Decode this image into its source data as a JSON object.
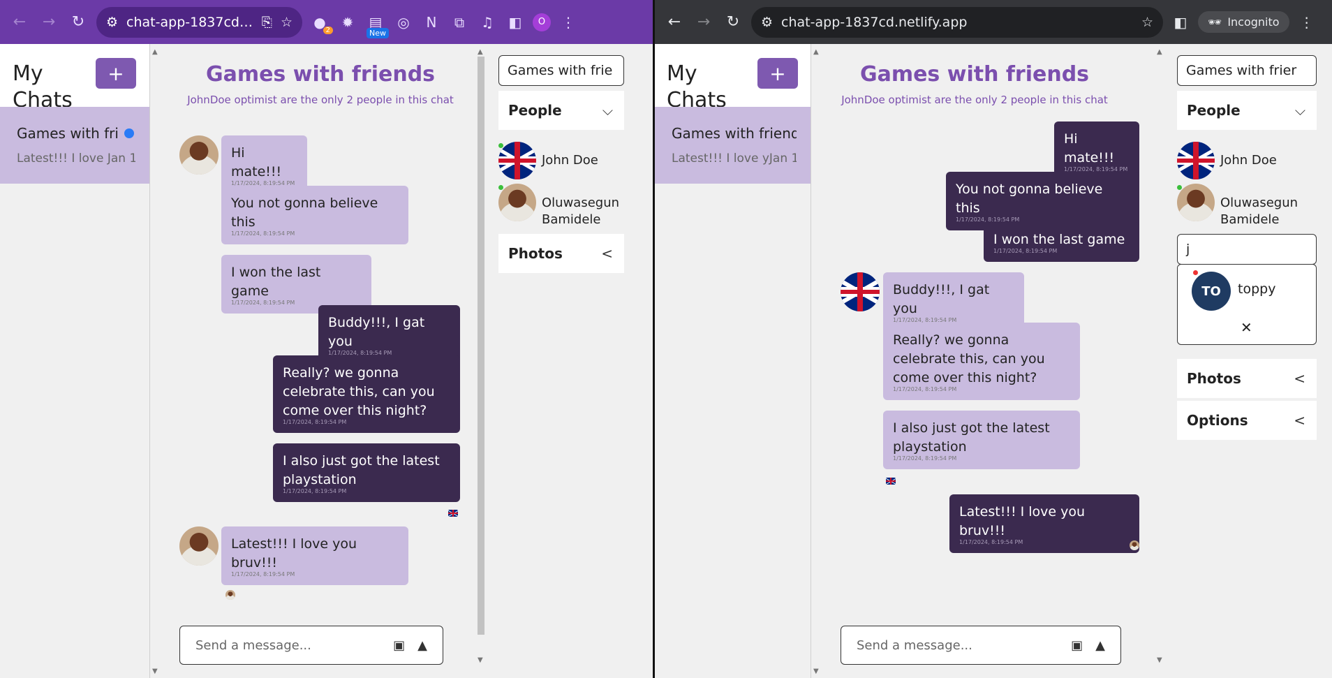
{
  "left_window": {
    "url": "chat-app-1837cd.n...",
    "ext_badge": "2",
    "new_badge": "New",
    "profile_letter": "O"
  },
  "right_window": {
    "url": "chat-app-1837cd.netlify.app",
    "incognito_label": "Incognito"
  },
  "chats": {
    "heading": "My Chats",
    "add_label": "+",
    "left_item": {
      "name": "Games with fri",
      "latest": "Latest!!! I love Jan 1"
    },
    "right_item": {
      "name": "Games with friend",
      "latest": "Latest!!! I love yJan 1"
    }
  },
  "conversation": {
    "title": "Games with friends",
    "subtitle": "JohnDoe optimist are the only 2 people in this chat",
    "timestamp": "1/17/2024, 8:19:54 PM",
    "messages": [
      "Hi mate!!!",
      "You not gonna believe this",
      "I won the last game",
      "Buddy!!!, I gat you",
      "Really? we gonna celebrate this, can you come over this night?",
      "I also just got the latest playstation",
      "Latest!!! I love you bruv!!!"
    ],
    "composer_placeholder": "Send a message..."
  },
  "sidebar": {
    "left_chat_name": "Games with frie",
    "right_chat_name": "Games with frier",
    "people_label": "People",
    "people": [
      "John Doe",
      "Oluwasegun Bamidele"
    ],
    "photos_label": "Photos",
    "options_label": "Options",
    "search_value": "j",
    "result_initials": "TO",
    "result_name": "toppy",
    "close_label": "✕"
  },
  "icons": {
    "back": "back-arrow-icon",
    "forward": "forward-arrow-icon",
    "reload": "reload-icon",
    "site_settings": "site-settings-icon",
    "star": "star-icon",
    "image": "image-icon",
    "send": "send-icon"
  },
  "colors": {
    "left_chrome": "#6b3aa7",
    "right_chrome": "#35363a",
    "accent": "#7b4fae",
    "incoming_bubble": "#c9bbdf",
    "outgoing_bubble": "#3b2a4f"
  }
}
